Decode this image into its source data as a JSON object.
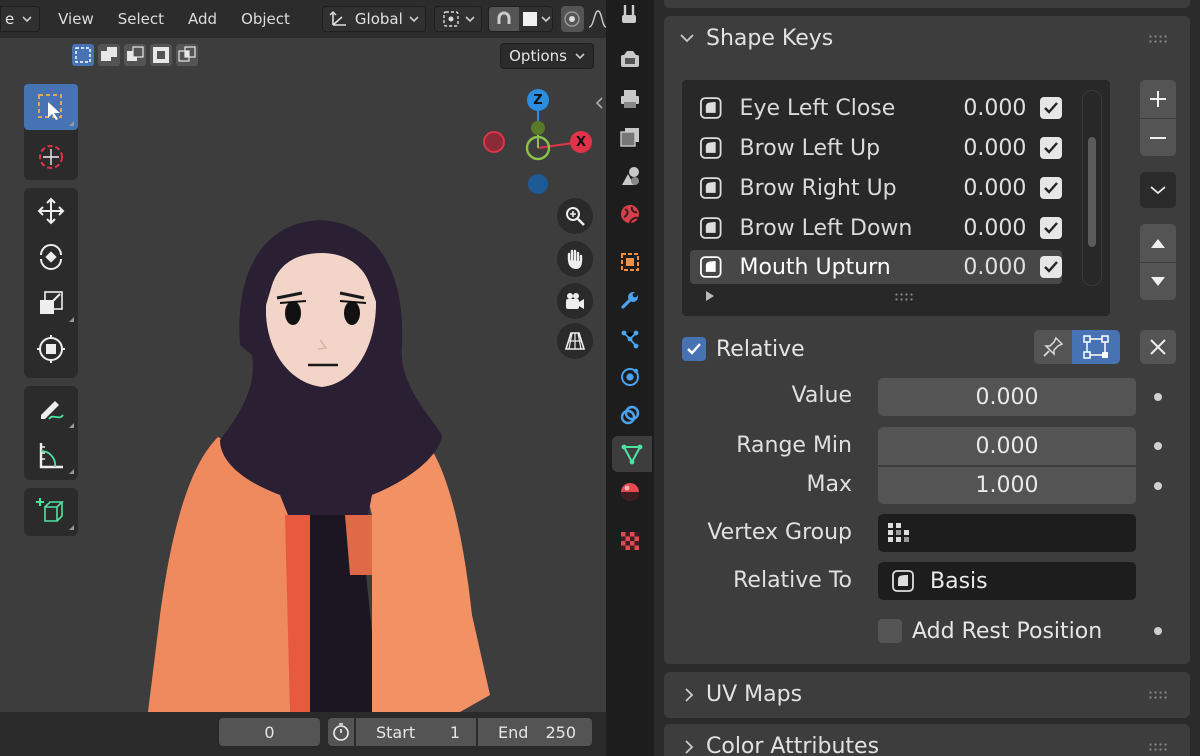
{
  "viewport": {
    "header": {
      "editor_fragment": "e",
      "menus": [
        "View",
        "Select",
        "Add",
        "Object"
      ],
      "transform_orientation": "Global"
    },
    "options_label": "Options",
    "gizmo": {
      "z": "Z",
      "x": "X"
    }
  },
  "timeline": {
    "current_frame": "0",
    "start_label": "Start",
    "start_value": "1",
    "end_label": "End",
    "end_value": "250"
  },
  "properties": {
    "shape_keys": {
      "title": "Shape Keys",
      "items": [
        {
          "name": "Eye Left Close",
          "value": "0.000",
          "checked": true
        },
        {
          "name": "Brow Left Up",
          "value": "0.000",
          "checked": true
        },
        {
          "name": "Brow Right Up",
          "value": "0.000",
          "checked": true
        },
        {
          "name": "Brow Left Down",
          "value": "0.000",
          "checked": true
        },
        {
          "name": "Mouth Upturn",
          "value": "0.000",
          "checked": true
        }
      ],
      "relative_label": "Relative",
      "value_label": "Value",
      "value": "0.000",
      "range_min_label": "Range Min",
      "range_min": "0.000",
      "max_label": "Max",
      "max": "1.000",
      "vertex_group_label": "Vertex Group",
      "vertex_group_value": "",
      "relative_to_label": "Relative To",
      "relative_to_value": "Basis",
      "add_rest_label": "Add Rest Position"
    },
    "uv_maps": {
      "title": "UV Maps"
    },
    "color_attributes": {
      "title": "Color Attributes"
    }
  },
  "colors": {
    "accent": "#4772b3",
    "active_tab_green": "#4fe3a0",
    "axis_x": "#e0334a",
    "axis_y": "#8bc34a",
    "axis_z": "#2a8ee3"
  }
}
